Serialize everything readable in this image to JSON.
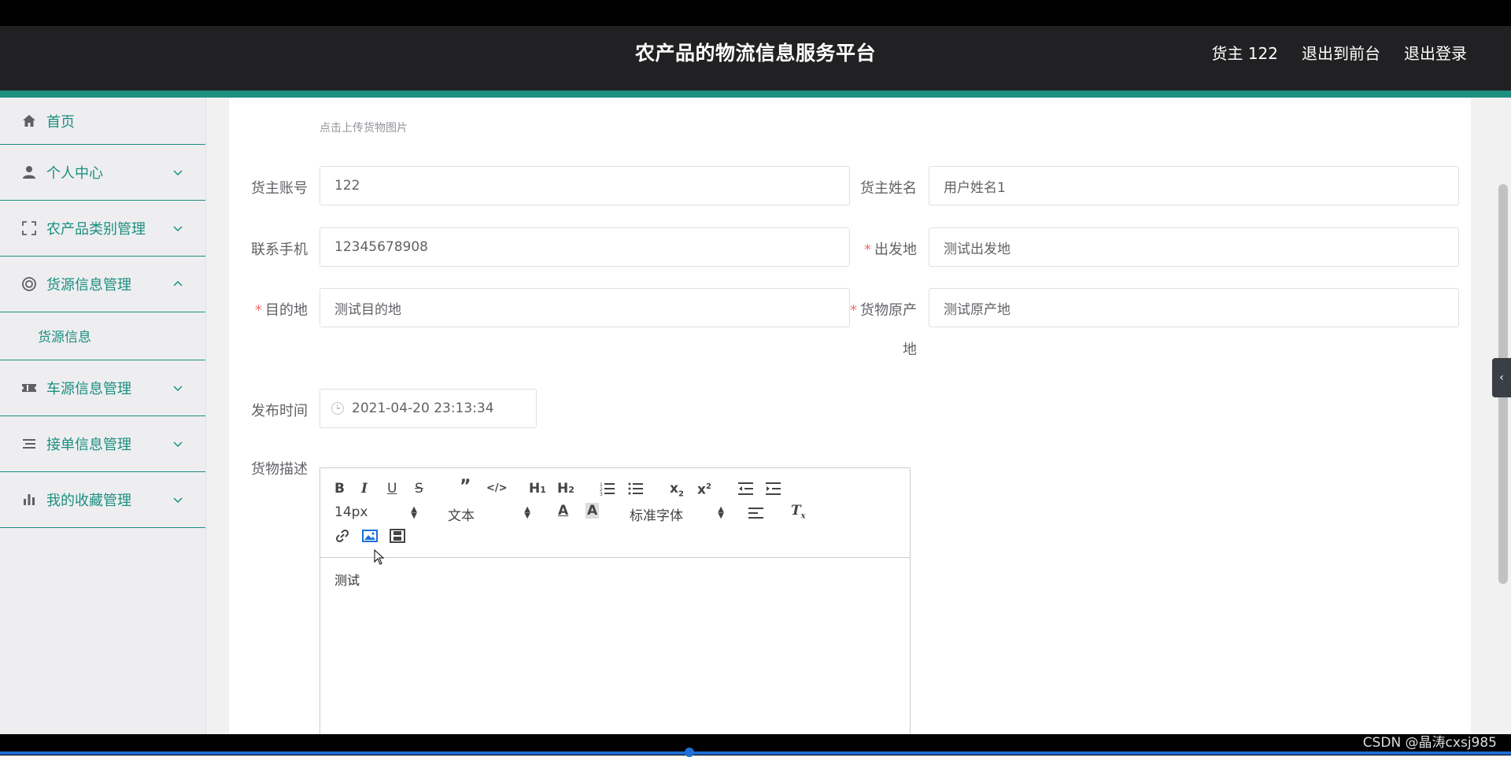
{
  "header": {
    "title": "农产品的物流信息服务平台",
    "user": "货主 122",
    "to_front": "退出到前台",
    "logout": "退出登录"
  },
  "sidebar": {
    "items": [
      {
        "label": "首页",
        "icon": "home-icon"
      },
      {
        "label": "个人中心",
        "icon": "user-icon",
        "chevron": "down"
      },
      {
        "label": "农产品类别管理",
        "icon": "fullscreen-icon",
        "chevron": "down"
      },
      {
        "label": "货源信息管理",
        "icon": "lifebuoy-icon",
        "chevron": "up"
      },
      {
        "label": "货源信息",
        "sub": true
      },
      {
        "label": "车源信息管理",
        "icon": "ticket-icon",
        "chevron": "down"
      },
      {
        "label": "接单信息管理",
        "icon": "list-icon",
        "chevron": "down"
      },
      {
        "label": "我的收藏管理",
        "icon": "bar-chart-icon",
        "chevron": "down"
      }
    ]
  },
  "form": {
    "upload_hint": "点击上传货物图片",
    "owner_account": {
      "label": "货主账号",
      "value": "122"
    },
    "owner_name": {
      "label": "货主姓名",
      "value": "用户姓名1"
    },
    "phone": {
      "label": "联系手机",
      "value": "12345678908"
    },
    "origin": {
      "label": "出发地",
      "value": "测试出发地"
    },
    "destination": {
      "label": "目的地",
      "value": "测试目的地"
    },
    "source_place": {
      "label_line1": "货物原产",
      "label_line2": "地",
      "value": "测试原产地"
    },
    "publish_time": {
      "label": "发布时间",
      "value": "2021-04-20 23:13:34"
    },
    "description": {
      "label": "货物描述"
    }
  },
  "editor": {
    "font_size": "14px",
    "heading": "文本",
    "font_family": "标准字体",
    "content": "测试"
  },
  "watermark": "CSDN @晶涛cxsj985",
  "colors": {
    "accent": "#1b8f80",
    "required": "#f56c6c"
  }
}
